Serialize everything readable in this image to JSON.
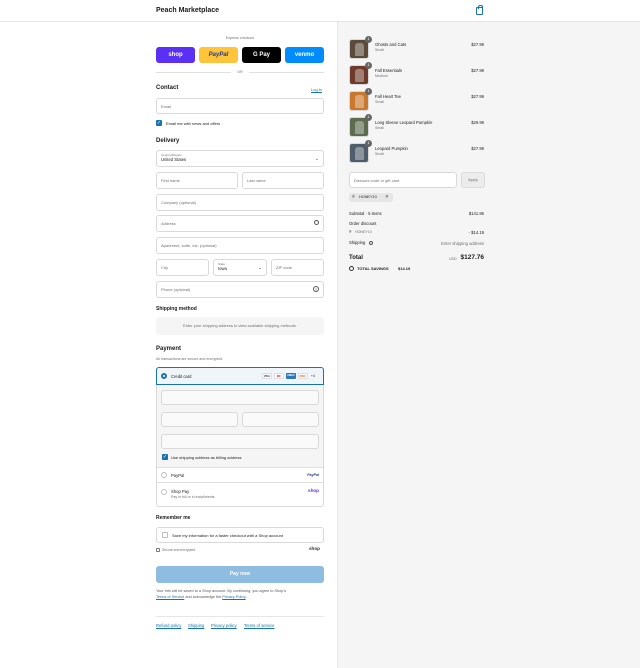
{
  "header": {
    "store_name": "Peach Marketplace"
  },
  "express": {
    "label": "Express checkout",
    "buttons": [
      {
        "label": "shop",
        "bg": "#5a31f4",
        "fg": "#ffffff"
      },
      {
        "label": "PayPal",
        "bg": "#ffc439",
        "fg": "#253b80"
      },
      {
        "label": "G Pay",
        "bg": "#000000",
        "fg": "#ffffff"
      },
      {
        "label": "venmo",
        "bg": "#008cff",
        "fg": "#ffffff"
      }
    ],
    "or": "OR"
  },
  "contact": {
    "title": "Contact",
    "login": "Log in",
    "email_placeholder": "Email",
    "news_label": "Email me with news and offers"
  },
  "delivery": {
    "title": "Delivery",
    "country_label": "Country/Region",
    "country_value": "United States",
    "first_name": "First name",
    "last_name": "Last name",
    "company": "Company (optional)",
    "address": "Address",
    "apartment": "Apartment, suite, etc. (optional)",
    "city": "City",
    "state_label": "State",
    "state_value": "Iowa",
    "zip": "ZIP code",
    "phone": "Phone (optional)"
  },
  "shipping_method": {
    "title": "Shipping method",
    "message": "Enter your shipping address to view available shipping methods."
  },
  "payment": {
    "title": "Payment",
    "subtitle": "All transactions are secure and encrypted.",
    "credit_card": "Credit card",
    "card_brands": [
      "VISA",
      "MC",
      "AMEX",
      "DISC"
    ],
    "more_cards": "+4",
    "billing_same": "Use shipping address as billing address",
    "paypal": "PayPal",
    "paypal_logo": "PayPal",
    "shop_pay": "Shop Pay",
    "shop_pay_sub": "Pay in full or in installments",
    "shop_logo": "shop"
  },
  "remember": {
    "title": "Remember me",
    "save_label": "Save my information for a faster checkout with a Shop account",
    "secure": "Secure and encrypted",
    "shop_logo": "shop"
  },
  "pay_button": "Pay now",
  "legal": {
    "line1": "Your info will be saved to a Shop account. By continuing, you agree to Shop's",
    "terms": "Terms of Service",
    "mid": " and acknowledge the ",
    "privacy": "Privacy Policy",
    "end": "."
  },
  "footer_links": [
    "Refund policy",
    "Shipping",
    "Privacy policy",
    "Terms of service"
  ],
  "cart": {
    "items": [
      {
        "name": "Ghosts and Cats",
        "variant": "Small",
        "price": "$27.99",
        "qty": "1",
        "color": "#5b4b3a"
      },
      {
        "name": "Fall Essentials",
        "variant": "Medium",
        "price": "$27.99",
        "qty": "1",
        "color": "#6e3b2a"
      },
      {
        "name": "Fall Heart Tee",
        "variant": "Small",
        "price": "$27.99",
        "qty": "1",
        "color": "#c8782f"
      },
      {
        "name": "Long Sleeve Leopard Pumpkin",
        "variant": "Small",
        "price": "$29.99",
        "qty": "1",
        "color": "#5d6b4f"
      },
      {
        "name": "Leopard Pumpkin",
        "variant": "Small",
        "price": "$27.99",
        "qty": "1",
        "color": "#4f5d6b"
      }
    ],
    "discount_placeholder": "Discount code or gift card",
    "apply": "Apply",
    "applied_code": "HONEY10",
    "subtotal_label": "Subtotal · 5 items",
    "subtotal_value": "$141.95",
    "order_discount_label": "Order discount",
    "discount_code": "HONEY10",
    "discount_value": "- $14.19",
    "shipping_label": "Shipping",
    "shipping_value": "Enter shipping address",
    "total_label": "Total",
    "currency": "USD",
    "total_value": "$127.76",
    "savings_label": "TOTAL SAVINGS",
    "savings_value": "$14.19"
  }
}
